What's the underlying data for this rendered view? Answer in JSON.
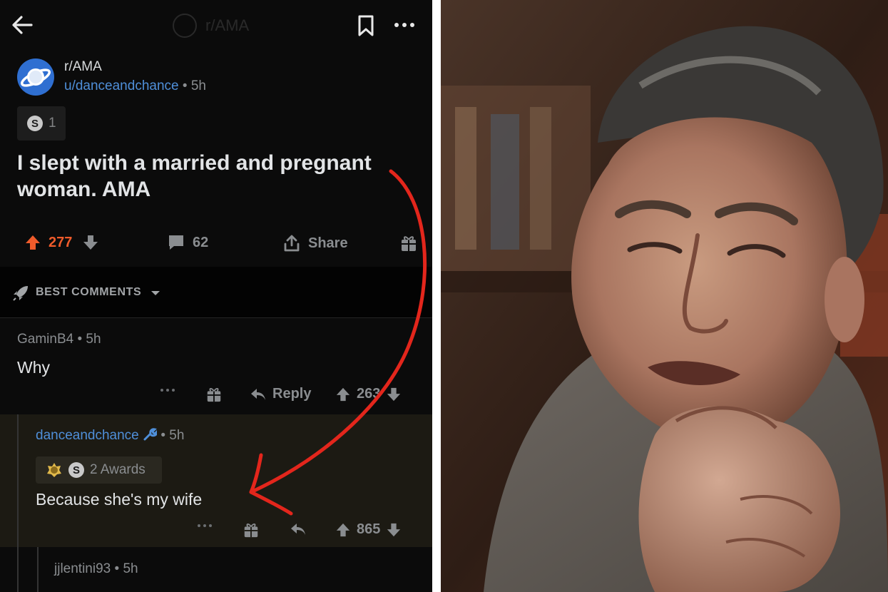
{
  "header": {
    "faint_subreddit": "r/AMA"
  },
  "post": {
    "subreddit": "r/AMA",
    "author": "u/danceandchance",
    "age": "5h",
    "award_count": "1",
    "title": "I slept with a married and pregnant woman. AMA",
    "upvotes": "277",
    "comments": "62",
    "share_label": "Share"
  },
  "sort": {
    "label": "BEST COMMENTS"
  },
  "comments": [
    {
      "author": "GaminB4",
      "age": "5h",
      "body": "Why",
      "reply_label": "Reply",
      "score": "263"
    },
    {
      "author": "danceandchance",
      "age": "5h",
      "awards_label": "2 Awards",
      "body": "Because she's my wife",
      "score": "865"
    },
    {
      "author": "jjlentini93",
      "age": "5h"
    }
  ],
  "colors": {
    "background": "#0b0b0b",
    "upvote_orange": "#ef5b2b",
    "link_blue": "#4f8fd9",
    "annotation_red": "#e3261c",
    "op_highlight": "#1c1a13"
  },
  "icons": [
    "back-arrow-icon",
    "bookmark-icon",
    "more-icon",
    "planet-icon",
    "silver-coin-icon",
    "upvote-icon",
    "downvote-icon",
    "comment-icon",
    "share-icon",
    "gift-icon",
    "rocket-icon",
    "caret-down-icon",
    "reply-icon",
    "wrench-icon",
    "gold-award-icon"
  ]
}
